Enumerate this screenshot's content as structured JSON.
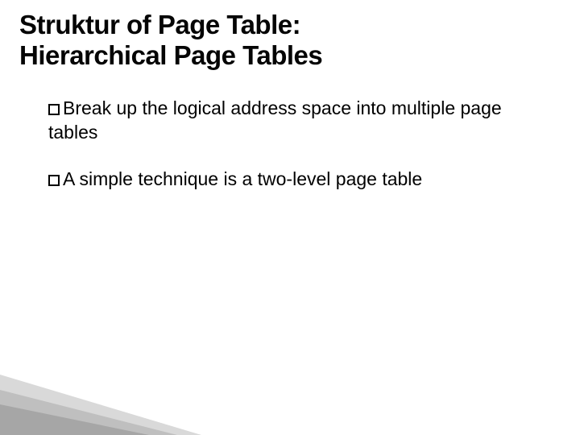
{
  "title_line1": "Struktur of Page Table:",
  "title_line2": "Hierarchical Page Tables",
  "bullets": [
    "Break up the logical address space into multiple page tables",
    "A simple technique is a two-level page table"
  ]
}
